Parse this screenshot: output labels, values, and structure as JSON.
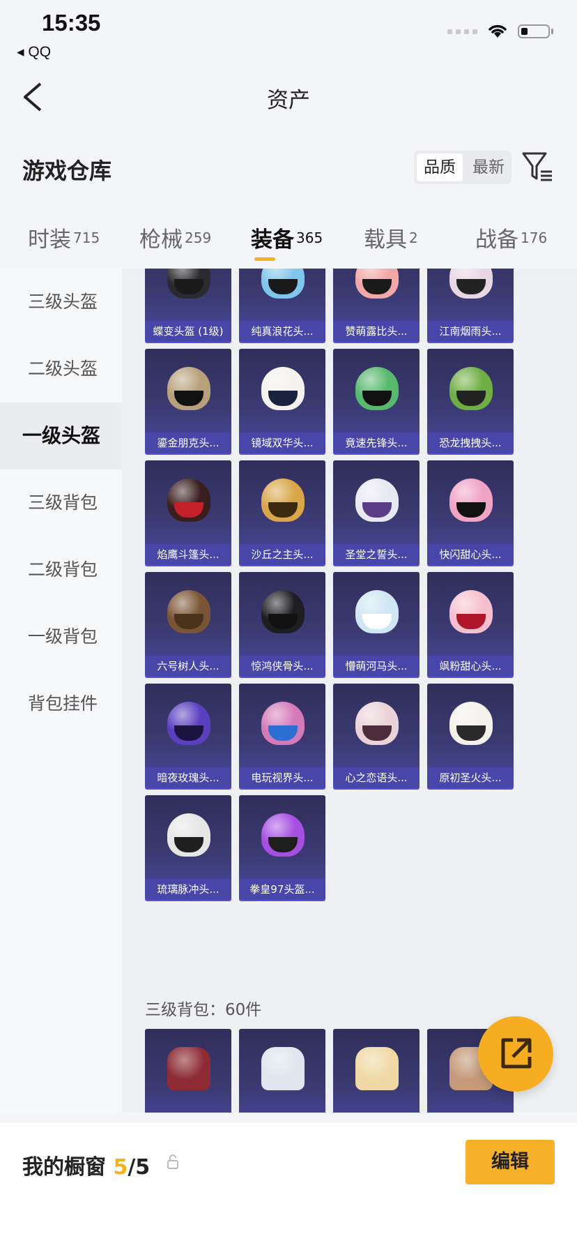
{
  "status_bar": {
    "time": "15:35",
    "back_app": "◂ QQ"
  },
  "nav": {
    "title": "资产"
  },
  "header": {
    "title": "游戏仓库",
    "sort_options": [
      "品质",
      "最新"
    ],
    "active_sort": 0
  },
  "tabs": [
    {
      "label": "时装",
      "count": "715"
    },
    {
      "label": "枪械",
      "count": "259"
    },
    {
      "label": "装备",
      "count": "365"
    },
    {
      "label": "载具",
      "count": "2"
    },
    {
      "label": "战备",
      "count": "176"
    }
  ],
  "active_tab": 2,
  "sidebar": {
    "items": [
      {
        "label": "三级头盔"
      },
      {
        "label": "二级头盔"
      },
      {
        "label": "一级头盔"
      },
      {
        "label": "三级背包"
      },
      {
        "label": "二级背包"
      },
      {
        "label": "一级背包"
      },
      {
        "label": "背包挂件"
      }
    ],
    "active": 2
  },
  "helmets": [
    {
      "name": "蝶变头盔 (1级)",
      "shell": "#2b2b2f",
      "visor": "#1a1a1a"
    },
    {
      "name": "纯真浪花头...",
      "shell": "#7ec6ea",
      "visor": "#1a1a1a"
    },
    {
      "name": "赞萌露比头...",
      "shell": "#f2a7a8",
      "visor": "#1a1a1a"
    },
    {
      "name": "江南烟雨头...",
      "shell": "#e9d6e4",
      "visor": "#222"
    },
    {
      "name": "鎏金朋克头...",
      "shell": "#b7a07a",
      "visor": "#111"
    },
    {
      "name": "镜域双华头...",
      "shell": "#f4f1ee",
      "visor": "#1b2240"
    },
    {
      "name": "竟速先锋头...",
      "shell": "#57b86e",
      "visor": "#111"
    },
    {
      "name": "恐龙拽拽头...",
      "shell": "#6fae43",
      "visor": "#222"
    },
    {
      "name": "焰鹰斗篷头...",
      "shell": "#3a1e1e",
      "visor": "#c4202b"
    },
    {
      "name": "沙丘之主头...",
      "shell": "#d9a64a",
      "visor": "#3b2a10"
    },
    {
      "name": "圣堂之誓头...",
      "shell": "#e8e8f2",
      "visor": "#5b3c86"
    },
    {
      "name": "快闪甜心头...",
      "shell": "#f0a3c4",
      "visor": "#111"
    },
    {
      "name": "六号树人头...",
      "shell": "#7a5535",
      "visor": "#4a321d"
    },
    {
      "name": "惊鸿侠骨头...",
      "shell": "#1e1e22",
      "visor": "#111"
    },
    {
      "name": "懵萌河马头...",
      "shell": "#cfe6f4",
      "visor": "#fff"
    },
    {
      "name": "飒粉甜心头...",
      "shell": "#f6bfcf",
      "visor": "#b0152a"
    },
    {
      "name": "暗夜玫瑰头...",
      "shell": "#5a3fbf",
      "visor": "#1b1440"
    },
    {
      "name": "电玩视界头...",
      "shell": "#d57ab8",
      "visor": "#2a6fd1"
    },
    {
      "name": "心之恋语头...",
      "shell": "#ead2d8",
      "visor": "#4d2c3c"
    },
    {
      "name": "原初圣火头...",
      "shell": "#f4f1ec",
      "visor": "#2a2a2a"
    },
    {
      "name": "琉璃脉冲头...",
      "shell": "#e6e6e6",
      "visor": "#1f1f1f"
    },
    {
      "name": "拳皇97头盔...",
      "shell": "#a54fe0",
      "visor": "#1e1e1e"
    }
  ],
  "backpack_section": {
    "label": "三级背包：60件"
  },
  "backpacks": [
    {
      "color": "#8e2b35"
    },
    {
      "color": "#dfe6ef"
    },
    {
      "color": "#f0d9a6"
    },
    {
      "color": "#c59a7a"
    }
  ],
  "bottom": {
    "title": "我的橱窗",
    "count_current": "5",
    "count_total": "/5",
    "edit_label": "编辑"
  },
  "colors": {
    "accent": "#f2b321",
    "card_bg": "#3b3a72",
    "card_label": "#4846a8"
  }
}
